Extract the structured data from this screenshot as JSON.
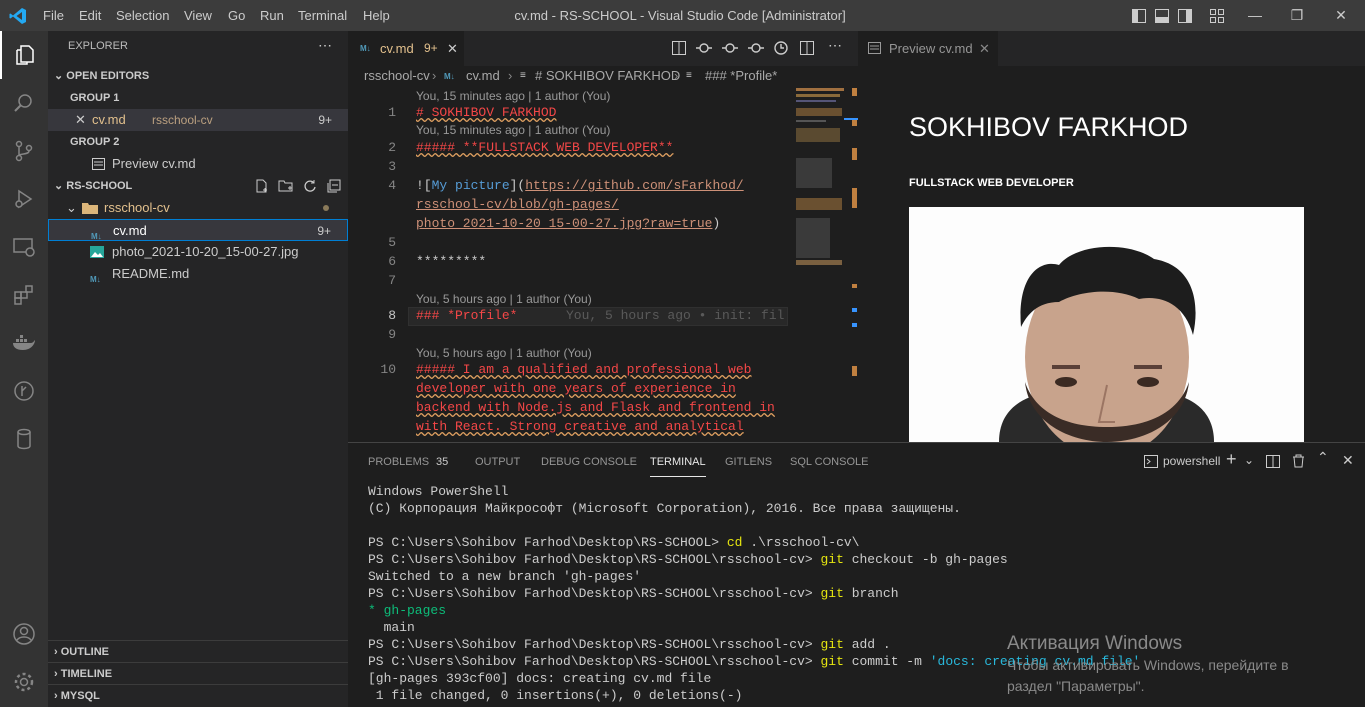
{
  "window": {
    "title": "cv.md - RS-SCHOOL - Visual Studio Code [Administrator]"
  },
  "menu": [
    "File",
    "Edit",
    "Selection",
    "View",
    "Go",
    "Run",
    "Terminal",
    "Help"
  ],
  "sidebar": {
    "title": "EXPLORER",
    "open_editors": "OPEN EDITORS",
    "group1": "GROUP 1",
    "group1_file": "cv.md",
    "group1_folder": "rsschool-cv",
    "group1_badge": "9+",
    "group2": "GROUP 2",
    "group2_file": "Preview cv.md",
    "workspace": "RS-SCHOOL",
    "folder": "rsschool-cv",
    "files": [
      {
        "name": "cv.md",
        "badge": "9+"
      },
      {
        "name": "photo_2021-10-20_15-00-27.jpg",
        "badge": ""
      },
      {
        "name": "README.md",
        "badge": ""
      }
    ],
    "outline": "OUTLINE",
    "timeline": "TIMELINE",
    "mysql": "MYSQL"
  },
  "editor": {
    "tab_label": "cv.md",
    "tab_badge": "9+",
    "breadcrumb": [
      "rsschool-cv",
      "cv.md",
      "# SOKHIBOV FARKHOD",
      "### *Profile*"
    ],
    "lens": {
      "l1": "You, 15 minutes ago | 1 author (You)",
      "l2": "You, 15 minutes ago | 1 author (You)",
      "l8": "You, 5 hours ago | 1 author (You)",
      "l10": "You, 5 hours ago | 1 author (You)"
    },
    "lines": {
      "n1": "1",
      "n2": "2",
      "n3": "3",
      "n4": "4",
      "n5": "5",
      "n6": "6",
      "n7": "7",
      "n8": "8",
      "n9": "9",
      "n10": "10",
      "c1": "# SOKHIBOV FARKHOD",
      "c2": "##### **FULLSTACK WEB DEVELOPER**",
      "c4a_pre": "![",
      "c4a_alt": "My picture",
      "c4a_mid": "](",
      "c4a_url": "https://github.com/sFarkhod/",
      "c4b": "rsschool-cv/blob/gh-pages/",
      "c4c": "photo_2021-10-20_15-00-27.jpg?raw=true",
      "c4c_close": ")",
      "c6": "*********",
      "c8": "### *Profile*",
      "c8_blame": "You, 5 hours ago • init: fil",
      "c10a": "##### I am a qualified and professional web",
      "c10b": "developer with one years of experience in",
      "c10c": "backend with Node.js and Flask and frontend in",
      "c10d": "with React. Strong creative and analytical"
    }
  },
  "preview": {
    "tab_label": "Preview cv.md",
    "heading": "SOKHIBOV FARKHOD",
    "subheading": "FULLSTACK WEB DEVELOPER"
  },
  "panel": {
    "tabs": [
      "PROBLEMS",
      "OUTPUT",
      "DEBUG CONSOLE",
      "TERMINAL",
      "GITLENS",
      "SQL CONSOLE"
    ],
    "problems_count": "35",
    "shell": "powershell",
    "terminal": {
      "t1": "Windows PowerShell",
      "t2": "(C) Корпорация Майкрософт (Microsoft Corporation), 2016. Все права защищены.",
      "prompt1": "PS C:\\Users\\Sohibov Farhod\\Desktop\\RS-SCHOOL> ",
      "cmd1": "cd",
      "arg1": " .\\rsschool-cv\\",
      "prompt2": "PS C:\\Users\\Sohibov Farhod\\Desktop\\RS-SCHOOL\\rsschool-cv> ",
      "cmd2": "git",
      "arg2": " checkout -b gh-pages",
      "out2": "Switched to a new branch 'gh-pages'",
      "prompt3": "PS C:\\Users\\Sohibov Farhod\\Desktop\\RS-SCHOOL\\rsschool-cv> ",
      "cmd3": "git",
      "arg3": " branch",
      "out3a": "* gh-pages",
      "out3b": "  main",
      "prompt4": "PS C:\\Users\\Sohibov Farhod\\Desktop\\RS-SCHOOL\\rsschool-cv> ",
      "cmd4": "git",
      "arg4": " add .",
      "prompt5": "PS C:\\Users\\Sohibov Farhod\\Desktop\\RS-SCHOOL\\rsschool-cv> ",
      "cmd5": "git",
      "arg5": " commit -m ",
      "str5": "'docs: creating cv.md file'",
      "out5a": "[gh-pages 393cf00] docs: creating cv.md file",
      "out5b": " 1 file changed, 0 insertions(+), 0 deletions(-)"
    }
  },
  "watermark": {
    "title": "Активация Windows",
    "line1": "Чтобы активировать Windows, перейдите в",
    "line2": "раздел \"Параметры\"."
  }
}
